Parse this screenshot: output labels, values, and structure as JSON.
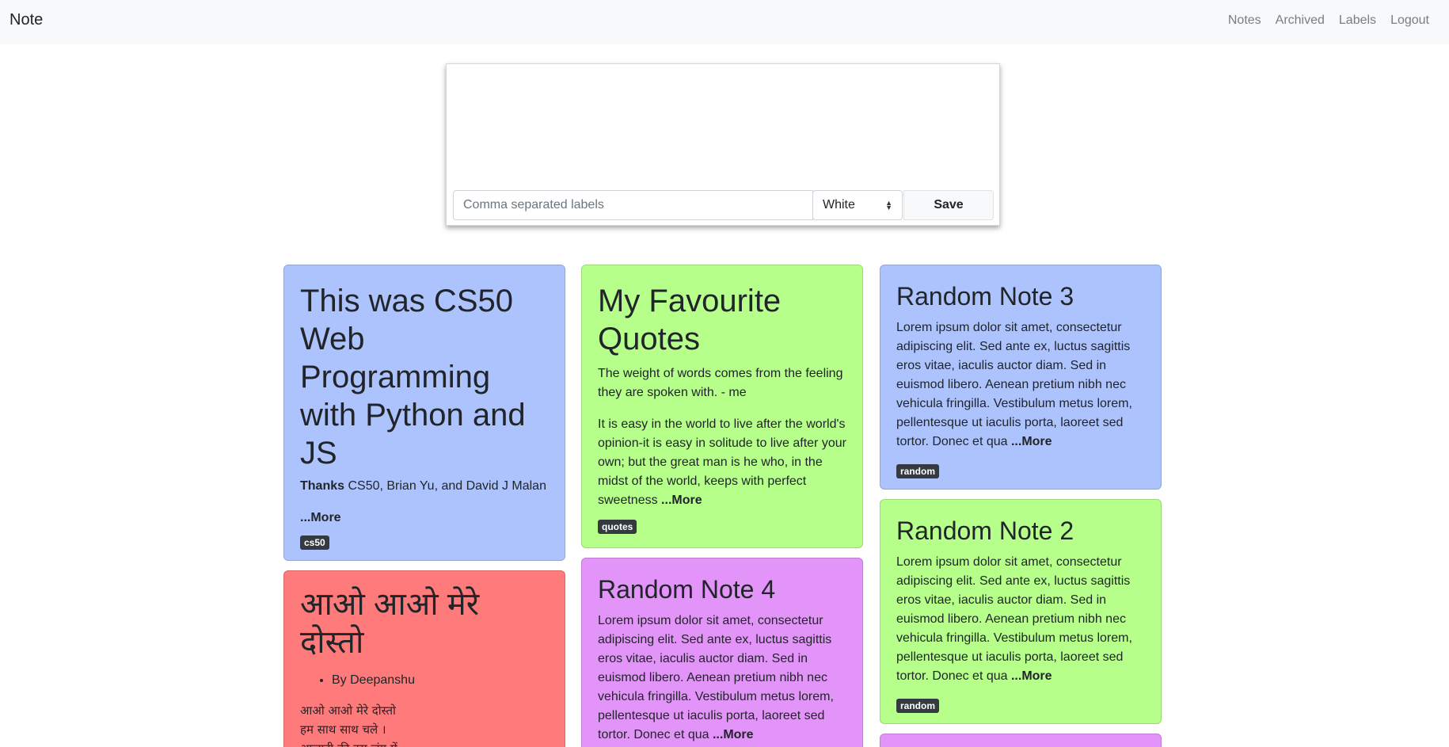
{
  "navbar": {
    "brand": "Note",
    "links": [
      "Notes",
      "Archived",
      "Labels",
      "Logout"
    ]
  },
  "composer": {
    "labels_placeholder": "Comma separated labels",
    "color_selected": "White",
    "save_label": "Save"
  },
  "cards": [
    {
      "title": "This was CS50 Web Programming with Python and JS",
      "thanks_bold": "Thanks",
      "thanks_text": " CS50, Brian Yu, and David J Malan",
      "more": "...More",
      "label": "cs50",
      "color": "#adc3fd"
    },
    {
      "title": "आओ आओ मेरे दोस्तो",
      "list_item": "By Deepanshu",
      "poem_lines": [
        "आओ आओ मेरे दोस्तो",
        "हम साथ साथ चले ।",
        "आजादी की इस जंग में"
      ],
      "color": "#ff7b7b"
    },
    {
      "title": "My Favourite Quotes",
      "p1": "The weight of words comes from the feeling they are spoken with. - me",
      "p2": "It is easy in the world to live after the world's opinion-it is easy in solitude to live after your own; but the great man is he who, in the midst of the world, keeps with perfect sweetness ",
      "more": "...More",
      "label": "quotes",
      "color": "#b5ff8a"
    },
    {
      "title": "Random Note 4",
      "body": "Lorem ipsum dolor sit amet, consectetur adipiscing elit. Sed ante ex, luctus sagittis eros vitae, iaculis auctor diam. Sed in euismod libero. Aenean pretium nibh nec vehicula fringilla. Vestibulum metus lorem, pellentesque ut iaculis porta, laoreet sed tortor. Donec et qua ",
      "more": "...More",
      "color": "#e394f8"
    },
    {
      "title": "Random Note 3",
      "body": "Lorem ipsum dolor sit amet, consectetur adipiscing elit. Sed ante ex, luctus sagittis eros vitae, iaculis auctor diam. Sed in euismod libero. Aenean pretium nibh nec vehicula fringilla. Vestibulum metus lorem, pellentesque ut iaculis porta, laoreet sed tortor. Donec et qua ",
      "more": "...More",
      "label": "random",
      "color": "#adc3fd"
    },
    {
      "title": "Random Note 2",
      "body": "Lorem ipsum dolor sit amet, consectetur adipiscing elit. Sed ante ex, luctus sagittis eros vitae, iaculis auctor diam. Sed in euismod libero. Aenean pretium nibh nec vehicula fringilla. Vestibulum metus lorem, pellentesque ut iaculis porta, laoreet sed tortor. Donec et qua ",
      "more": "...More",
      "label": "random",
      "color": "#b5ff8a"
    },
    {
      "color": "#e394f8"
    }
  ]
}
